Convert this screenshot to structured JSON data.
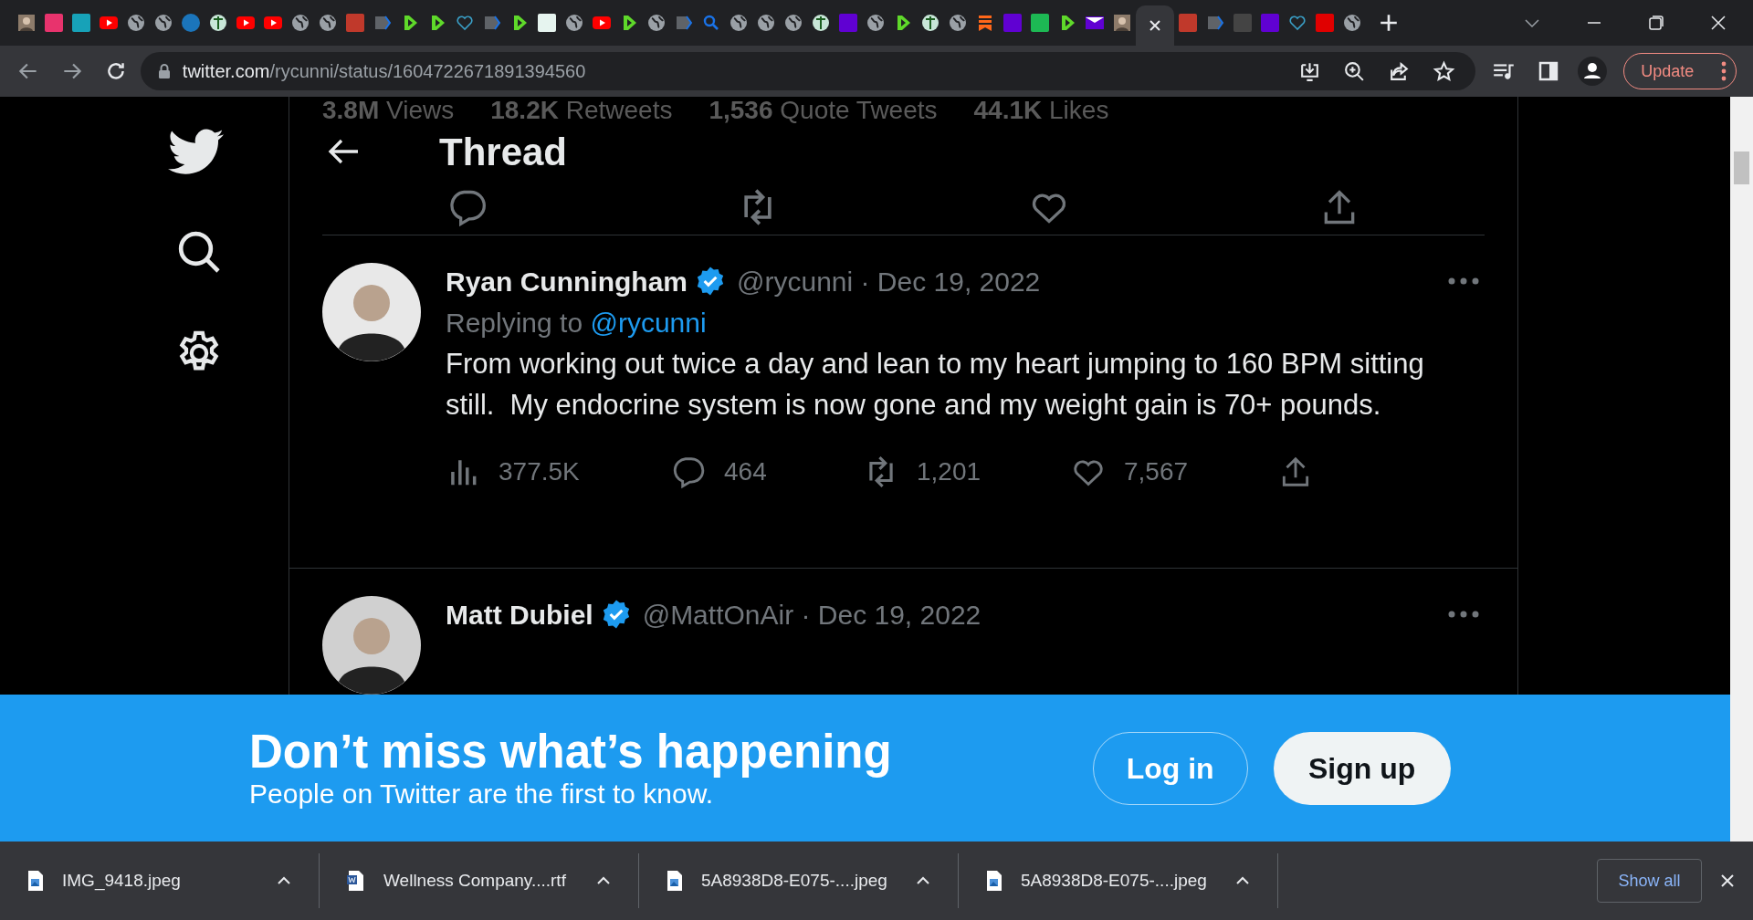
{
  "tabs": [
    {
      "kind": "photo",
      "selected": false
    },
    {
      "kind": "badge",
      "color": "#e8336d",
      "selected": false
    },
    {
      "kind": "badge",
      "color": "#17a2b8",
      "selected": false
    },
    {
      "kind": "youtube",
      "selected": false
    },
    {
      "kind": "globe",
      "selected": false
    },
    {
      "kind": "globe",
      "selected": false
    },
    {
      "kind": "circle",
      "color": "#1b75bb",
      "selected": false
    },
    {
      "kind": "medical",
      "selected": false
    },
    {
      "kind": "youtube",
      "selected": false
    },
    {
      "kind": "youtube",
      "selected": false
    },
    {
      "kind": "globe",
      "selected": false
    },
    {
      "kind": "globe",
      "selected": false
    },
    {
      "kind": "badge",
      "color": "#c0392b",
      "selected": false
    },
    {
      "kind": "arrow",
      "selected": false
    },
    {
      "kind": "play",
      "selected": false
    },
    {
      "kind": "play",
      "selected": false
    },
    {
      "kind": "heart",
      "selected": false
    },
    {
      "kind": "arrow",
      "selected": false
    },
    {
      "kind": "play",
      "selected": false
    },
    {
      "kind": "badge",
      "color": "#e6f4ef",
      "selected": false
    },
    {
      "kind": "globe",
      "selected": false
    },
    {
      "kind": "youtube",
      "selected": false
    },
    {
      "kind": "play",
      "selected": false
    },
    {
      "kind": "globe",
      "selected": false
    },
    {
      "kind": "arrow",
      "selected": false
    },
    {
      "kind": "search",
      "selected": false
    },
    {
      "kind": "globe",
      "selected": false
    },
    {
      "kind": "globe",
      "selected": false
    },
    {
      "kind": "globe",
      "selected": false
    },
    {
      "kind": "medical",
      "selected": false
    },
    {
      "kind": "badge",
      "color": "#6001d2",
      "selected": false
    },
    {
      "kind": "globe",
      "selected": false
    },
    {
      "kind": "play",
      "selected": false
    },
    {
      "kind": "medical",
      "selected": false
    },
    {
      "kind": "globe",
      "selected": false
    },
    {
      "kind": "bookmark",
      "selected": false
    },
    {
      "kind": "badge",
      "color": "#6001d2",
      "selected": false
    },
    {
      "kind": "badge",
      "color": "#1db954",
      "selected": false
    },
    {
      "kind": "play",
      "selected": false
    },
    {
      "kind": "mail",
      "selected": false
    },
    {
      "kind": "photo",
      "selected": false
    },
    {
      "kind": "active",
      "selected": true
    },
    {
      "kind": "badge",
      "color": "#c0392b",
      "selected": false
    },
    {
      "kind": "arrow",
      "selected": false
    },
    {
      "kind": "badge",
      "color": "#444444",
      "selected": false
    },
    {
      "kind": "badge",
      "color": "#6001d2",
      "selected": false
    },
    {
      "kind": "heart",
      "selected": false
    },
    {
      "kind": "badge",
      "color": "#e00000",
      "selected": false
    },
    {
      "kind": "globe",
      "selected": false
    }
  ],
  "address_bar": {
    "domain": "twitter.com",
    "path": "/rycunni/status/1604722671891394560"
  },
  "update_button": "Update",
  "background_stats": [
    "**3.8M** Views",
    "**18.2K** Retweets",
    "**1,536** Quote Tweets",
    "**44.1K** Likes"
  ],
  "header": {
    "title": "Thread"
  },
  "tweets": [
    {
      "name": "Ryan Cunningham",
      "handle": "@rycunni · Dec 19, 2022",
      "replying_label": "Replying to",
      "replying_to": "@rycunni",
      "text": "From working out twice a day and lean to my heart jumping to 160 BPM sitting still.  My endocrine system is now gone and my weight gain is 70+ pounds.",
      "views": "377.5K",
      "replies": "464",
      "retweets": "1,201",
      "likes": "7,567"
    },
    {
      "name": "Matt Dubiel",
      "handle": "@MattOnAir · Dec 19, 2022"
    }
  ],
  "banner": {
    "title": "Don’t miss what’s happening",
    "subtitle": "People on Twitter are the first to know.",
    "login": "Log in",
    "signup": "Sign up"
  },
  "downloads": [
    {
      "kind": "image",
      "name": "IMG_9418.jpeg"
    },
    {
      "kind": "word",
      "name": "Wellness Company....rtf"
    },
    {
      "kind": "image",
      "name": "5A8938D8-E075-....jpeg"
    },
    {
      "kind": "image",
      "name": "5A8938D8-E075-....jpeg"
    }
  ],
  "show_all": "Show all"
}
